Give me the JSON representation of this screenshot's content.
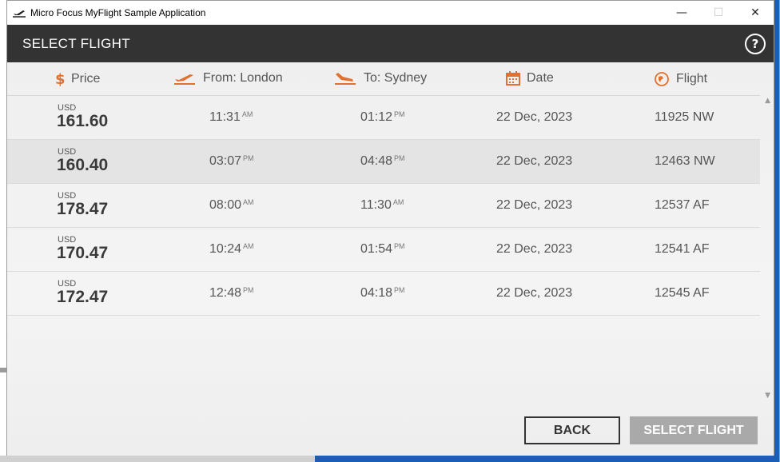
{
  "window": {
    "title": "Micro Focus MyFlight Sample Application",
    "minimize_glyph": "—",
    "maximize_glyph": "☐",
    "close_glyph": "✕"
  },
  "header": {
    "title": "SELECT FLIGHT",
    "help_label": "?"
  },
  "columns": {
    "price": "Price",
    "from": "From: London",
    "to": "To: Sydney",
    "date": "Date",
    "flight": "Flight"
  },
  "icons": {
    "price": "dollar-icon",
    "from": "plane-takeoff-icon",
    "to": "plane-landing-icon",
    "date": "calendar-icon",
    "flight": "globe-icon",
    "accent_color": "#e2702f"
  },
  "flights": [
    {
      "currency": "USD",
      "price": "161.60",
      "depart_time": "11:31",
      "depart_ampm": "AM",
      "arrive_time": "01:12",
      "arrive_ampm": "PM",
      "date": "22 Dec, 2023",
      "flight": "11925 NW"
    },
    {
      "currency": "USD",
      "price": "160.40",
      "depart_time": "03:07",
      "depart_ampm": "PM",
      "arrive_time": "04:48",
      "arrive_ampm": "PM",
      "date": "22 Dec, 2023",
      "flight": "12463 NW"
    },
    {
      "currency": "USD",
      "price": "178.47",
      "depart_time": "08:00",
      "depart_ampm": "AM",
      "arrive_time": "11:30",
      "arrive_ampm": "AM",
      "date": "22 Dec, 2023",
      "flight": "12537 AF"
    },
    {
      "currency": "USD",
      "price": "170.47",
      "depart_time": "10:24",
      "depart_ampm": "AM",
      "arrive_time": "01:54",
      "arrive_ampm": "PM",
      "date": "22 Dec, 2023",
      "flight": "12541 AF"
    },
    {
      "currency": "USD",
      "price": "172.47",
      "depart_time": "12:48",
      "depart_ampm": "PM",
      "arrive_time": "04:18",
      "arrive_ampm": "PM",
      "date": "22 Dec, 2023",
      "flight": "12545 AF"
    }
  ],
  "selected_row": 1,
  "buttons": {
    "back": "BACK",
    "select": "SELECT FLIGHT"
  }
}
